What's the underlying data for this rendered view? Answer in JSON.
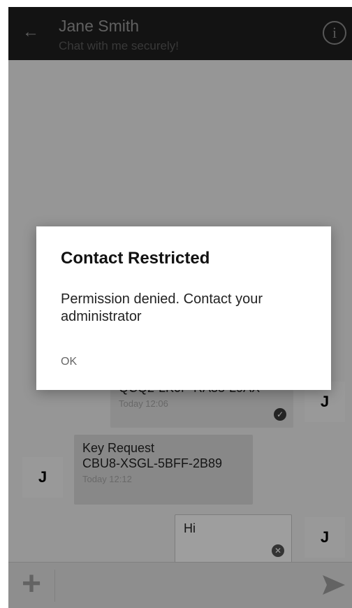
{
  "header": {
    "title": "Jane Smith",
    "subtitle": "Chat with me securely!"
  },
  "messages": [
    {
      "text": "QCQ2-LK0P-RA33-L9AX",
      "time": "Today 12:06",
      "avatar": "J"
    },
    {
      "text": "Key Request\nCBU8-XSGL-5BFF-2B89",
      "time": "Today 12:12",
      "avatar": "J"
    },
    {
      "text": "Hi",
      "avatar": "J"
    }
  ],
  "dialog": {
    "title": "Contact Restricted",
    "message": "Permission denied. Contact your administrator",
    "ok_label": "OK"
  },
  "input": {
    "placeholder": ""
  }
}
